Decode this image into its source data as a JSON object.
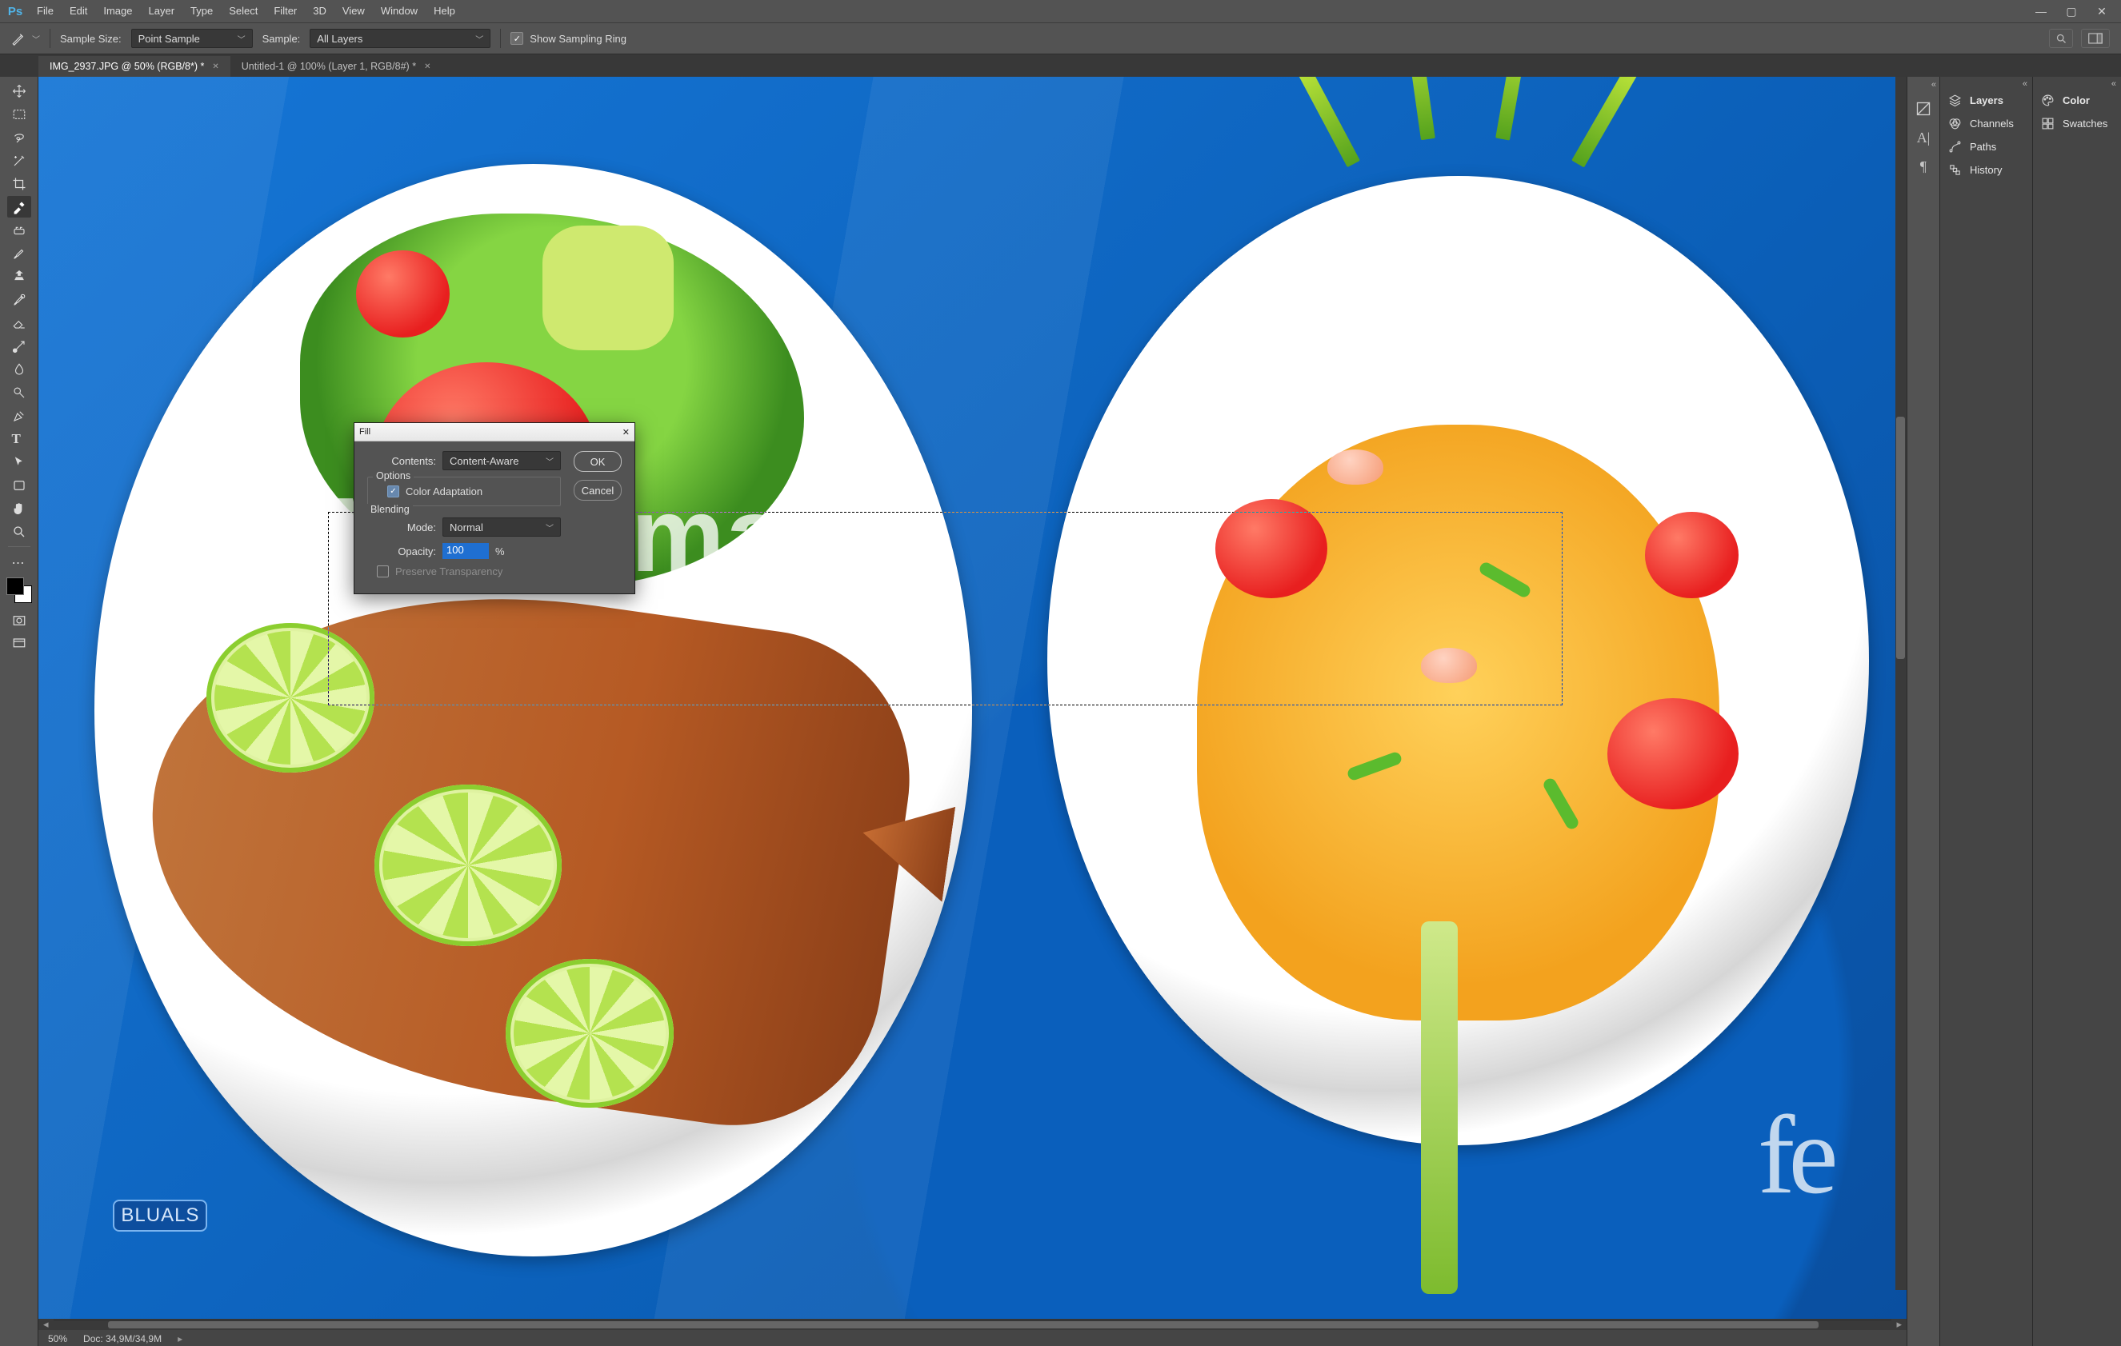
{
  "app": {
    "logo": "Ps"
  },
  "menu": [
    "File",
    "Edit",
    "Image",
    "Layer",
    "Type",
    "Select",
    "Filter",
    "3D",
    "View",
    "Window",
    "Help"
  ],
  "optionsBar": {
    "sampleSizeLabel": "Sample Size:",
    "sampleSizeValue": "Point Sample",
    "sampleLabel": "Sample:",
    "sampleValue": "All Layers",
    "showRing": "Show Sampling Ring"
  },
  "tabs": [
    {
      "title": "IMG_2937.JPG @ 50% (RGB/8*) *",
      "active": true
    },
    {
      "title": "Untitled-1 @ 100% (Layer 1, RGB/8#) *",
      "active": false
    }
  ],
  "status": {
    "zoom": "50%",
    "doc": "Doc: 34,9M/34,9M"
  },
  "canvas": {
    "watermark": "Watermark",
    "cornerText1": "BLUALS",
    "cornerText2": "fe"
  },
  "dialog": {
    "title": "Fill",
    "contentsLabel": "Contents:",
    "contentsValue": "Content-Aware",
    "optionsGroup": "Options",
    "colorAdaptation": "Color Adaptation",
    "blendingGroup": "Blending",
    "modeLabel": "Mode:",
    "modeValue": "Normal",
    "opacityLabel": "Opacity:",
    "opacityValue": "100",
    "opacityUnit": "%",
    "preserve": "Preserve Transparency",
    "ok": "OK",
    "cancel": "Cancel"
  },
  "panels1": [
    {
      "label": "Layers",
      "bold": true,
      "icon": "layers"
    },
    {
      "label": "Channels",
      "bold": false,
      "icon": "channels"
    },
    {
      "label": "Paths",
      "bold": false,
      "icon": "paths"
    },
    {
      "label": "History",
      "bold": false,
      "icon": "history"
    }
  ],
  "panels2": [
    {
      "label": "Color",
      "bold": true,
      "icon": "color"
    },
    {
      "label": "Swatches",
      "bold": false,
      "icon": "swatches"
    }
  ]
}
